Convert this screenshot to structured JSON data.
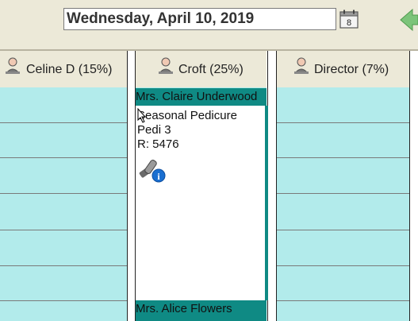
{
  "toolbar": {
    "date": "Wednesday, April 10, 2019",
    "calendar_icon": "calendar-icon",
    "next_icon": "arrow-left-green-icon"
  },
  "columns": [
    {
      "label": "Celine D (15%)",
      "icon": "staff-avatar-icon"
    },
    {
      "label": "Croft (25%)",
      "icon": "staff-avatar-icon"
    },
    {
      "label": "Director (7%)",
      "icon": "staff-avatar-icon"
    }
  ],
  "appointments": [
    {
      "client": "Mrs. Claire Underwood",
      "service": "Seasonal Pedicure",
      "station": "Pedi 3",
      "ref": "R: 5476",
      "icon": "tools-info-icon"
    },
    {
      "client": "Mrs. Alice Flowers"
    }
  ],
  "colors": {
    "slot": "#b2ebeb",
    "appointment": "#0f8a84",
    "header": "#ece9d8"
  }
}
